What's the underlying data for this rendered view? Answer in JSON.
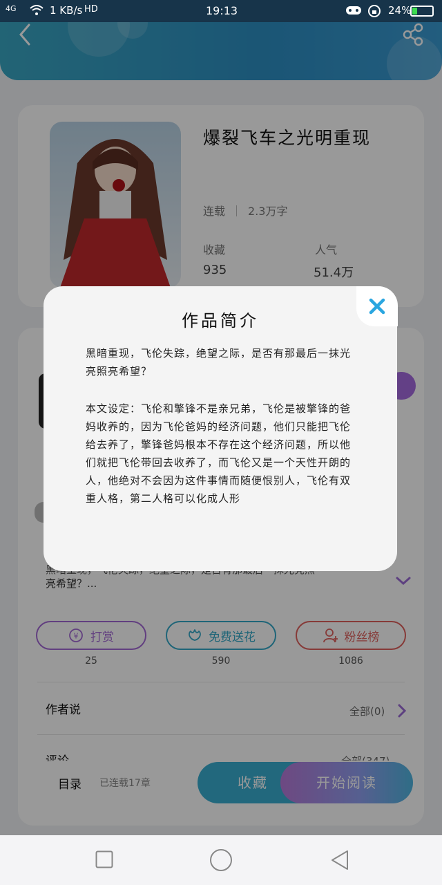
{
  "status_bar": {
    "network": "4G",
    "speed": "1 KB/s",
    "hd": "HD",
    "time": "19:13",
    "battery": "24%",
    "battery_level": 0.24
  },
  "book": {
    "title": "爆裂飞车之光明重现",
    "status": "连载",
    "word_count": "2.3万字",
    "favorites_label": "收藏",
    "favorites_value": "935",
    "popularity_label": "人气",
    "popularity_value": "51.4万"
  },
  "synopsis_preview": {
    "line1": "黑暗重现，飞伦失踪，绝望之际，是否有那最后一抹光亮照",
    "line2": "亮希望？..."
  },
  "actions": [
    {
      "label": "打赏",
      "count": "25",
      "color": "#a46ad6"
    },
    {
      "label": "免费送花",
      "count": "590",
      "color": "#35a9c8"
    },
    {
      "label": "粉丝榜",
      "count": "1086",
      "color": "#e0625e"
    }
  ],
  "author_says": {
    "label": "作者说",
    "all": "全部(0)"
  },
  "comments": {
    "label": "评论",
    "all": "全部(347)"
  },
  "bottom": {
    "toc_label": "目录",
    "toc_sub": "已连载17章",
    "fav_button": "收藏",
    "read_button": "开始阅读"
  },
  "modal": {
    "title": "作品简介",
    "p1": "黑暗重现，飞伦失踪，绝望之际，是否有那最后一抹光亮照亮希望？",
    "p2": "本文设定：飞伦和擎锋不是亲兄弟，飞伦是被擎锋的爸妈收养的，因为飞伦爸妈的经济问题，他们只能把飞伦给去养了，擎锋爸妈根本不存在这个经济问题，所以他们就把飞伦带回去收养了，而飞伦又是一个天性开朗的人，他绝对不会因为这件事情而随便恨别人，飞伦有双重人格，第二人格可以化成人形"
  }
}
